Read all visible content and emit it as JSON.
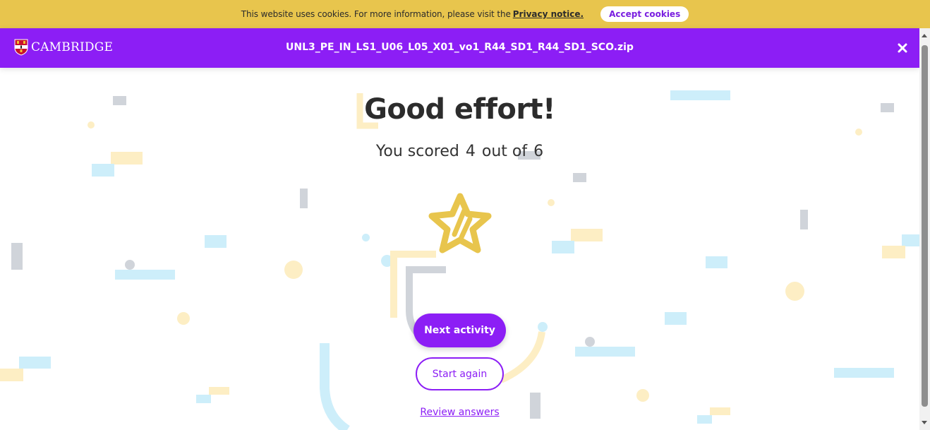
{
  "cookie_bar": {
    "message": "This website uses cookies. For more information, please visit the",
    "link_label": "Privacy notice.",
    "accept_label": "Accept cookies"
  },
  "header": {
    "brand": "CAMBRIDGE",
    "file_title": "UNL3_PE_IN_LS1_U06_L05_X01_vo1_R44_SD1_R44_SD1_SCO.zip",
    "close_icon": "close-icon"
  },
  "result": {
    "headline": "Good effort!",
    "score_prefix": "You scored",
    "score": "4",
    "score_middle": "out of",
    "total": "6",
    "star_icon": "star-icon"
  },
  "actions": {
    "next_label": "Next activity",
    "again_label": "Start again",
    "review_label": "Review answers"
  },
  "colors": {
    "accent": "#8c1ef5",
    "cookie_bar": "#e8c54d",
    "star": "#e8c54d"
  }
}
